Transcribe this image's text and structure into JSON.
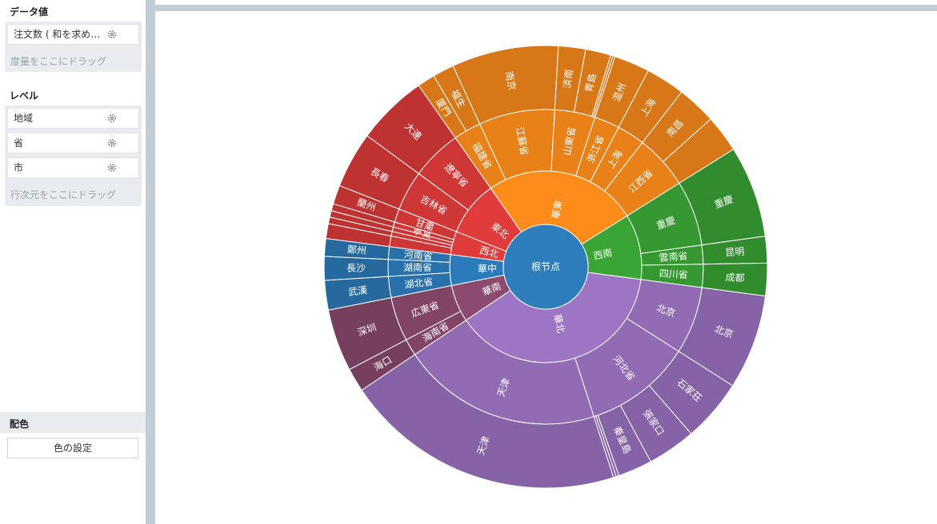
{
  "panel": {
    "data_title": "データ値",
    "measure_field": "注文数 ( 和を求め…",
    "measure_hint": "度量をここにドラッグ",
    "level_title": "レベル",
    "levels": [
      "地域",
      "省",
      "市"
    ],
    "dim_hint": "行次元をここにドラッグ",
    "color_title": "配色",
    "color_button": "色の設定"
  },
  "chart_data": {
    "type": "sunburst",
    "root": "根节点",
    "regions": [
      {
        "name": "華東",
        "color": "#fd8c1b",
        "children": [
          {
            "name": "福建省",
            "value": 6.6,
            "children": [
              {
                "name": "厦門",
                "value": 3.0
              },
              {
                "name": "福生",
                "value": 3.6
              }
            ]
          },
          {
            "name": "江蘇省",
            "value": 18.0,
            "children": [
              {
                "name": "南京",
                "value": 18.0
              }
            ]
          },
          {
            "name": "山東省",
            "value": 9.6,
            "children": [
              {
                "name": "済南",
                "value": 6.0
              },
              {
                "name": "青島",
                "value": 5.6
              },
              {
                "name": "",
                "value": 0.5
              },
              {
                "name": "",
                "value": 0.5
              }
            ]
          },
          {
            "name": "浙江省",
            "value": 6.0,
            "children": [
              {
                "name": "温州",
                "value": 6.0
              }
            ]
          },
          {
            "name": "上海",
            "value": 6.6,
            "children": [
              {
                "name": "上海",
                "value": 6.6
              }
            ]
          },
          {
            "name": "江西省",
            "value": 12.9,
            "children": [
              {
                "name": "南昌",
                "value": 6.6
              },
              {
                "name": "",
                "value": 6.3
              }
            ]
          }
        ]
      },
      {
        "name": "西南",
        "color": "#3aa535",
        "children": [
          {
            "name": "重慶",
            "value": 15.5,
            "children": [
              {
                "name": "重慶",
                "value": 15.5
              }
            ]
          },
          {
            "name": "雲南省",
            "value": 4.5,
            "children": [
              {
                "name": "昆明",
                "value": 4.5
              }
            ]
          },
          {
            "name": "四川省",
            "value": 5.5,
            "children": [
              {
                "name": "成都",
                "value": 5.5
              }
            ]
          }
        ]
      },
      {
        "name": "華北",
        "color": "#9e75c4",
        "children": [
          {
            "name": "北京",
            "value": 16.0,
            "children": [
              {
                "name": "北京",
                "value": 16.0
              }
            ]
          },
          {
            "name": "河北省",
            "value": 25.5,
            "children": [
              {
                "name": "石家荘",
                "value": 11.0
              },
              {
                "name": "張家口",
                "value": 8.5
              },
              {
                "name": "秦皇島",
                "value": 6.0
              },
              {
                "name": "",
                "value": 0.5
              },
              {
                "name": "",
                "value": 0.5
              }
            ]
          },
          {
            "name": "天津",
            "value": 47.5,
            "children": [
              {
                "name": "天津",
                "value": 47.5
              }
            ]
          }
        ]
      },
      {
        "name": "華南",
        "color": "#8c4a6e",
        "children": [
          {
            "name": "海南省",
            "value": 4.0,
            "children": [
              {
                "name": "海口",
                "value": 4.0
              }
            ]
          },
          {
            "name": "広東省",
            "value": 10.5,
            "children": [
              {
                "name": "深圳",
                "value": 10.5
              }
            ]
          }
        ]
      },
      {
        "name": "華中",
        "color": "#2b7bba",
        "children": [
          {
            "name": "湖北省",
            "value": 5.0,
            "children": [
              {
                "name": "武漢",
                "value": 5.0
              }
            ]
          },
          {
            "name": "湖南省",
            "value": 4.0,
            "children": [
              {
                "name": "長沙",
                "value": 4.0
              }
            ]
          },
          {
            "name": "河南省",
            "value": 3.0,
            "children": [
              {
                "name": "鄭州",
                "value": 3.0
              }
            ]
          }
        ]
      },
      {
        "name": "西北",
        "color": "#e03c3b",
        "children": [
          {
            "name": "",
            "value": 2.5,
            "children": [
              {
                "name": "",
                "value": 2.5
              }
            ]
          },
          {
            "name": "",
            "value": 1.1,
            "children": [
              {
                "name": "",
                "value": 1.1
              }
            ]
          },
          {
            "name": "",
            "value": 1.1,
            "children": [
              {
                "name": "",
                "value": 1.1
              }
            ]
          },
          {
            "name": "寧夏",
            "value": 1.2,
            "children": [
              {
                "name": "",
                "value": 1.2
              }
            ]
          },
          {
            "name": "甘粛",
            "value": 3.2,
            "children": [
              {
                "name": "蘭州",
                "value": 3.2
              }
            ]
          }
        ]
      },
      {
        "name": "東北",
        "color": "#e03c3b",
        "children": [
          {
            "name": "吉林省",
            "value": 9.5,
            "children": [
              {
                "name": "長春",
                "value": 9.5
              }
            ]
          },
          {
            "name": "遼寧省",
            "value": 12.0,
            "children": [
              {
                "name": "大連",
                "value": 12.0
              }
            ]
          }
        ]
      }
    ]
  }
}
